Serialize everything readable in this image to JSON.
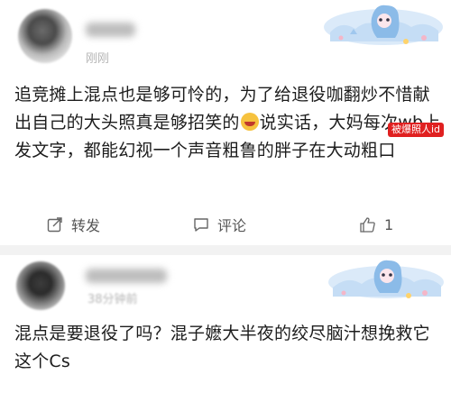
{
  "post1": {
    "meta": "刚刚",
    "badge_icon": "anime-girl-card-badge",
    "text_part1": "追竞摊上混点也是够可怜的，为了给退役咖翻炒不惜献出自己的大头照真是够招笑的",
    "emoji": "laughing-emoji",
    "text_part2": "说实话，大妈每次wb上发文字，都能幻视一个声音粗鲁的胖子在大动粗口",
    "watermark": "被爆照人id",
    "actions": {
      "share": "转发",
      "comment": "评论",
      "like_count": "1"
    }
  },
  "post2": {
    "meta": "38分钟前",
    "badge_icon": "anime-girl-card-badge",
    "text": "混点是要退役了吗？混子嬷大半夜的绞尽脑汁想挽救它这个Cs"
  },
  "colors": {
    "text": "#1d1d1d",
    "muted": "#b5b5b5",
    "watermark": "#e02020",
    "divider": "#f2f2f2"
  }
}
